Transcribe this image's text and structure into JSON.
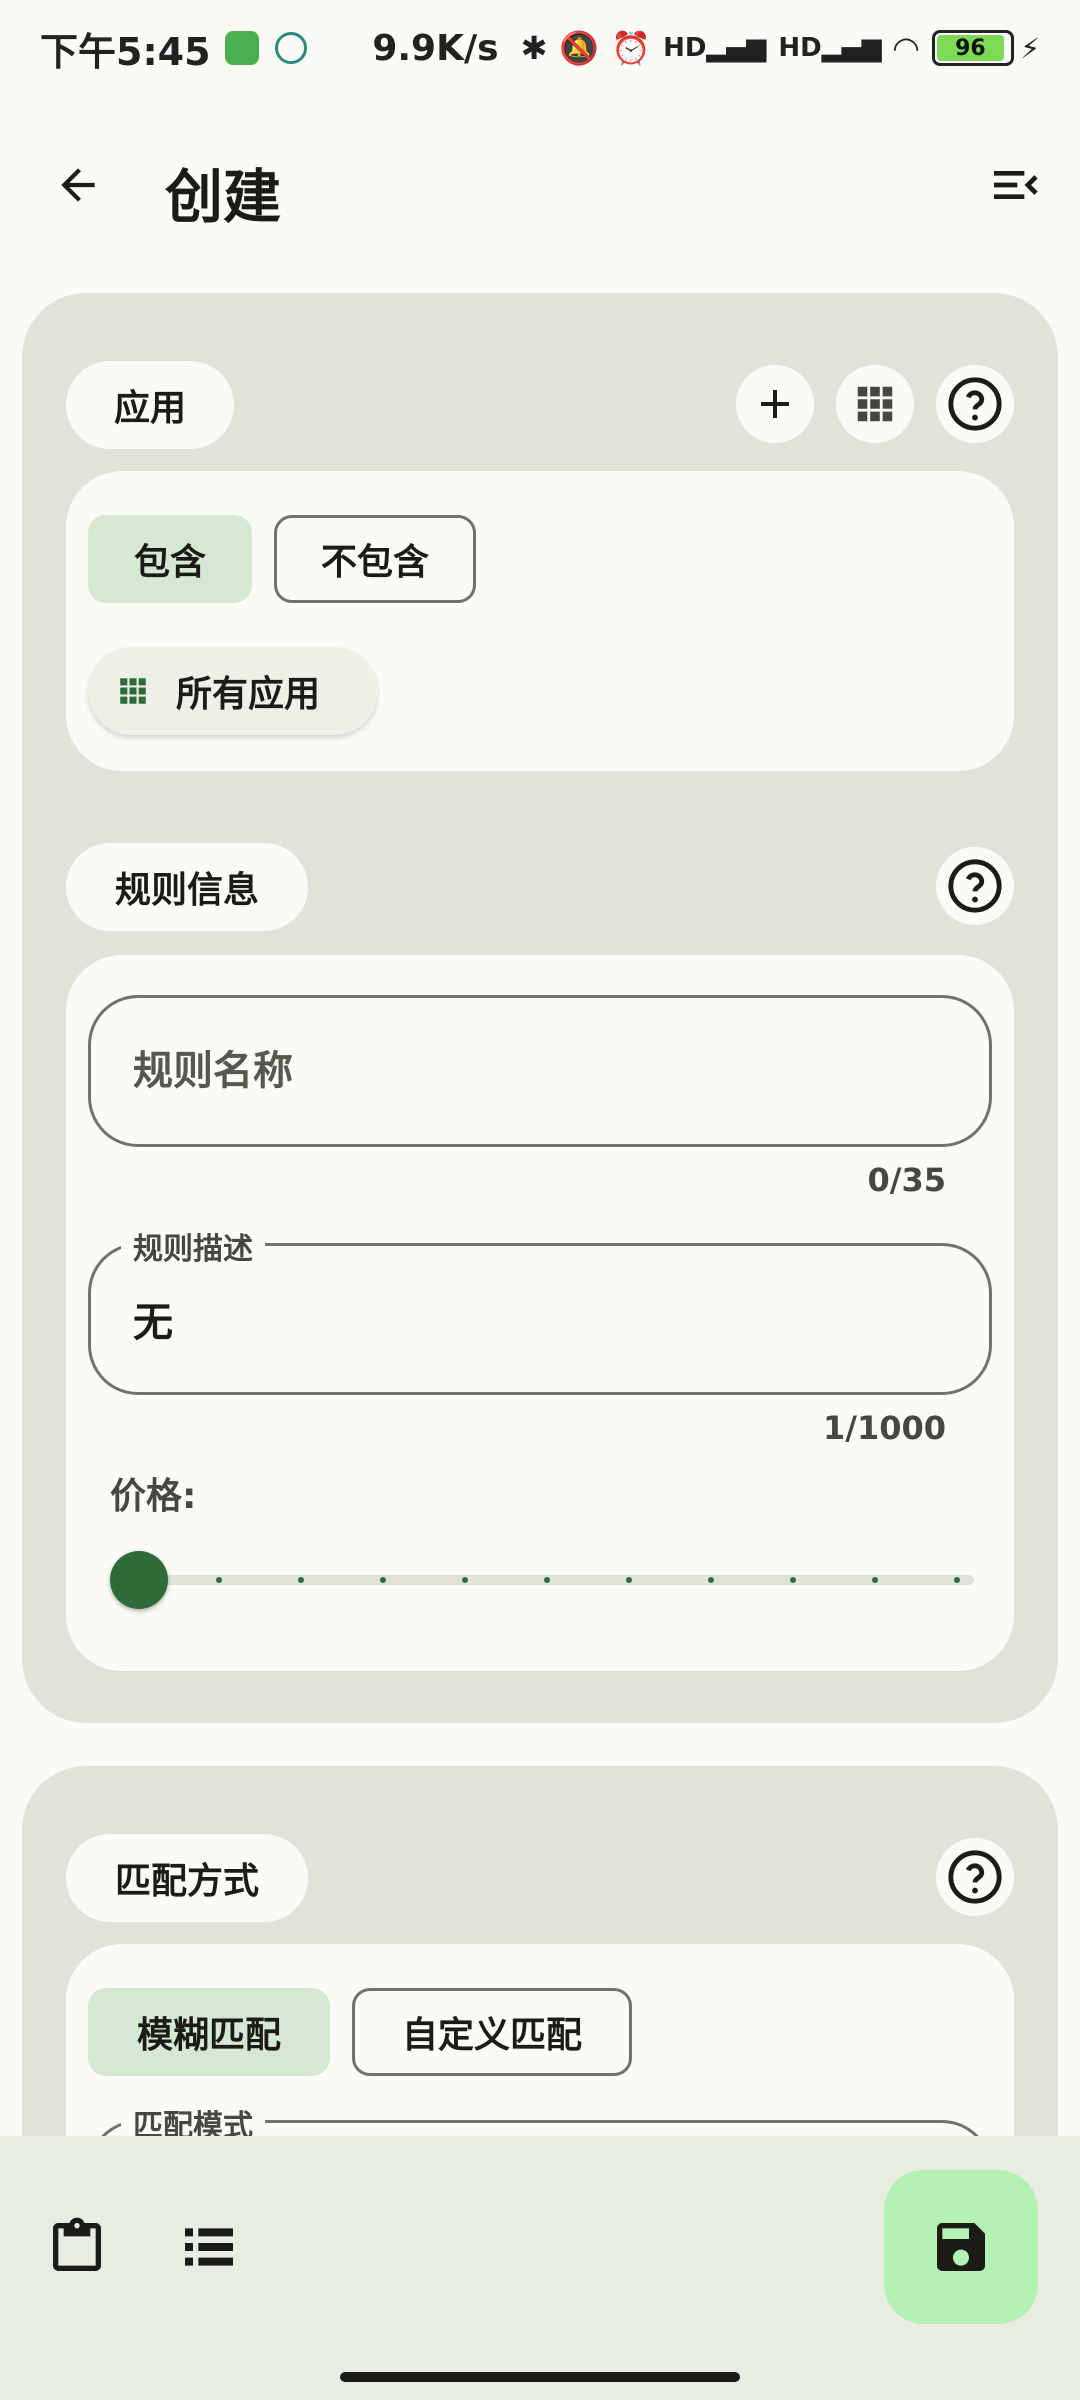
{
  "status_bar": {
    "time": "下午5:45",
    "net_speed": "9.9K/s",
    "battery": "96"
  },
  "app_bar": {
    "title": "创建",
    "back_icon": "arrow-back-icon",
    "menu_icon": "menu-collapse-icon"
  },
  "app_section": {
    "label": "应用",
    "include_chip": "包含",
    "exclude_chip": "不包含",
    "selected_mode": "包含",
    "all_apps_chip": "所有应用",
    "buttons": [
      "add-icon",
      "grid-icon",
      "help-icon"
    ]
  },
  "rule_info": {
    "label": "规则信息",
    "name_placeholder": "规则名称",
    "name_counter": "0/35",
    "desc_label": "规则描述",
    "desc_value": "无",
    "desc_counter": "1/1000",
    "price_label": "价格:",
    "price_value": 0
  },
  "match_section": {
    "label": "匹配方式",
    "fuzzy_chip": "模糊匹配",
    "custom_chip": "自定义匹配",
    "selected_mode": "模糊匹配",
    "mode_label": "匹配模式"
  },
  "bottom_bar": {
    "clipboard_icon": "clipboard-icon",
    "list_icon": "list-icon",
    "save_icon": "save-icon"
  },
  "colors": {
    "accent": "#2e6b3a",
    "chip_selected": "#d5e8d2",
    "fab": "#b5f1b3",
    "card_bg": "#dfe3da"
  }
}
